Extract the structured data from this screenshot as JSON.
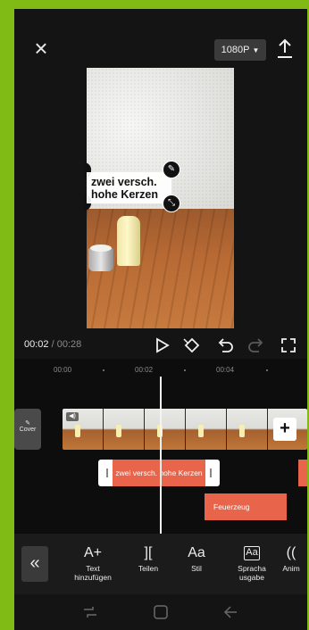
{
  "header": {
    "close_icon": "close-icon",
    "resolution": "1080P",
    "export_icon": "upload-icon"
  },
  "preview": {
    "text_line_1": "zwei versch.",
    "text_line_2": "hohe Kerzen"
  },
  "playback": {
    "current_time": "00:02",
    "separator": " / ",
    "total_time": "00:28",
    "icons": [
      "play-icon",
      "keyframe-icon",
      "undo-icon",
      "redo-icon",
      "fullscreen-icon"
    ]
  },
  "timeline": {
    "ruler_labels": [
      "00:00",
      "00:02",
      "00:04"
    ],
    "cover_label": "Cover",
    "clip_1_label": "zwei versch.  hohe Kerzen",
    "clip_2_label": "Feuerzeug"
  },
  "toolbar": {
    "items": [
      {
        "icon": "A+",
        "label_1": "Text",
        "label_2": "hinzufügen"
      },
      {
        "icon": "][",
        "label_1": "Teilen",
        "label_2": ""
      },
      {
        "icon": "Aa",
        "label_1": "Stil",
        "label_2": ""
      },
      {
        "icon": "Aa",
        "label_1": "Spracha",
        "label_2": "usgabe"
      },
      {
        "icon": "((",
        "label_1": "Anim",
        "label_2": ""
      }
    ]
  },
  "colors": {
    "accent": "#e8654b",
    "background": "#141414",
    "outer": "#7fba15"
  }
}
